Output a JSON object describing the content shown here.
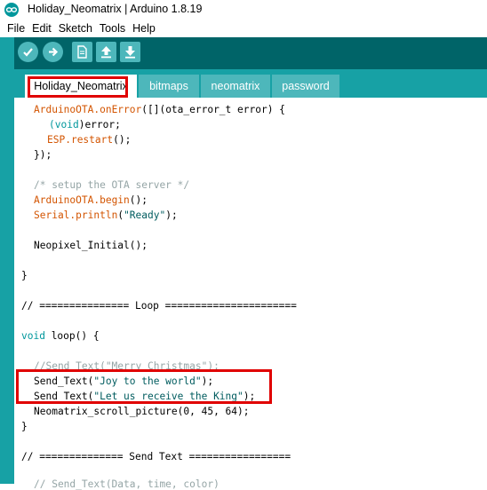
{
  "window": {
    "title": "Holiday_Neomatrix | Arduino 1.8.19",
    "app_icon": "arduino-logo-icon"
  },
  "menu": [
    "File",
    "Edit",
    "Sketch",
    "Tools",
    "Help"
  ],
  "toolbar": {
    "buttons": [
      {
        "name": "verify-icon"
      },
      {
        "name": "upload-icon"
      },
      {
        "name": "new-sketch-icon"
      },
      {
        "name": "open-sketch-icon"
      },
      {
        "name": "save-sketch-icon"
      }
    ]
  },
  "tabs": [
    {
      "label": "Holiday_Neomatrix",
      "active": true
    },
    {
      "label": "bitmaps",
      "active": false
    },
    {
      "label": "neomatrix",
      "active": false
    },
    {
      "label": "password",
      "active": false
    }
  ],
  "code": {
    "l1_obj": "ArduinoOTA.",
    "l1_fn": "onError",
    "l1_rest": "([](ota_error_t error) {",
    "l2_open": "(",
    "l2_kw": "void",
    "l2_rest": ")error;",
    "l3_obj": "ESP.",
    "l3_fn": "restart",
    "l3_rest": "();",
    "l4": "});",
    "l5_comment": "/* setup the OTA server */",
    "l6_obj": "ArduinoOTA.",
    "l6_fn": "begin",
    "l6_rest": "();",
    "l7_obj": "Serial.",
    "l7_fn": "println",
    "l7_open": "(",
    "l7_str": "\"Ready\"",
    "l7_rest": ");",
    "l8": "Neopixel_Initial();",
    "l9": "}",
    "l10": "// =============== Loop ======================",
    "l11_kw": "void",
    "l11_rest": " loop() {",
    "l12": "//Send_Text(\"Merry Christmas\");",
    "l13_fn": "Send_Text(",
    "l13_str": "\"Joy to the world\"",
    "l13_rest": ");",
    "l14_fn": "Send_Text(",
    "l14_str": "\"Let us receive the King\"",
    "l14_rest": ");",
    "l15": "Neomatrix_scroll_picture(0, 45, 64);",
    "l16": "}",
    "l17": "// ============== Send Text =================",
    "l18": "// Send_Text(Data, time, color)"
  },
  "colors": {
    "toolbar_bg": "#006468",
    "tab_strip_bg": "#17a1a5",
    "highlight_box": "#e00000",
    "keyword_orange": "#d35400",
    "keyword_teal": "#00979c"
  }
}
